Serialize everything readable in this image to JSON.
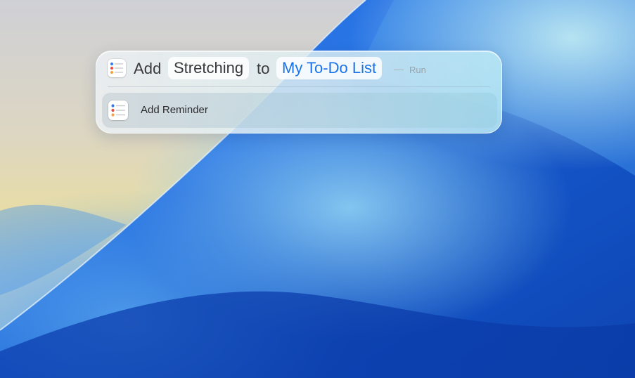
{
  "spotlight": {
    "app_icon": "reminders-icon",
    "query": {
      "verb": "Add",
      "item": "Stretching",
      "preposition": "to",
      "list": "My To-Do List",
      "separator": "—",
      "action": "Run"
    },
    "results": [
      {
        "icon": "reminders-icon",
        "label": "Add Reminder"
      }
    ]
  },
  "colors": {
    "accent_blue": "#1a73e8",
    "reminder_dot_blue": "#2f7bf5",
    "reminder_dot_red": "#f0493e",
    "reminder_dot_orange": "#f7a13a"
  }
}
